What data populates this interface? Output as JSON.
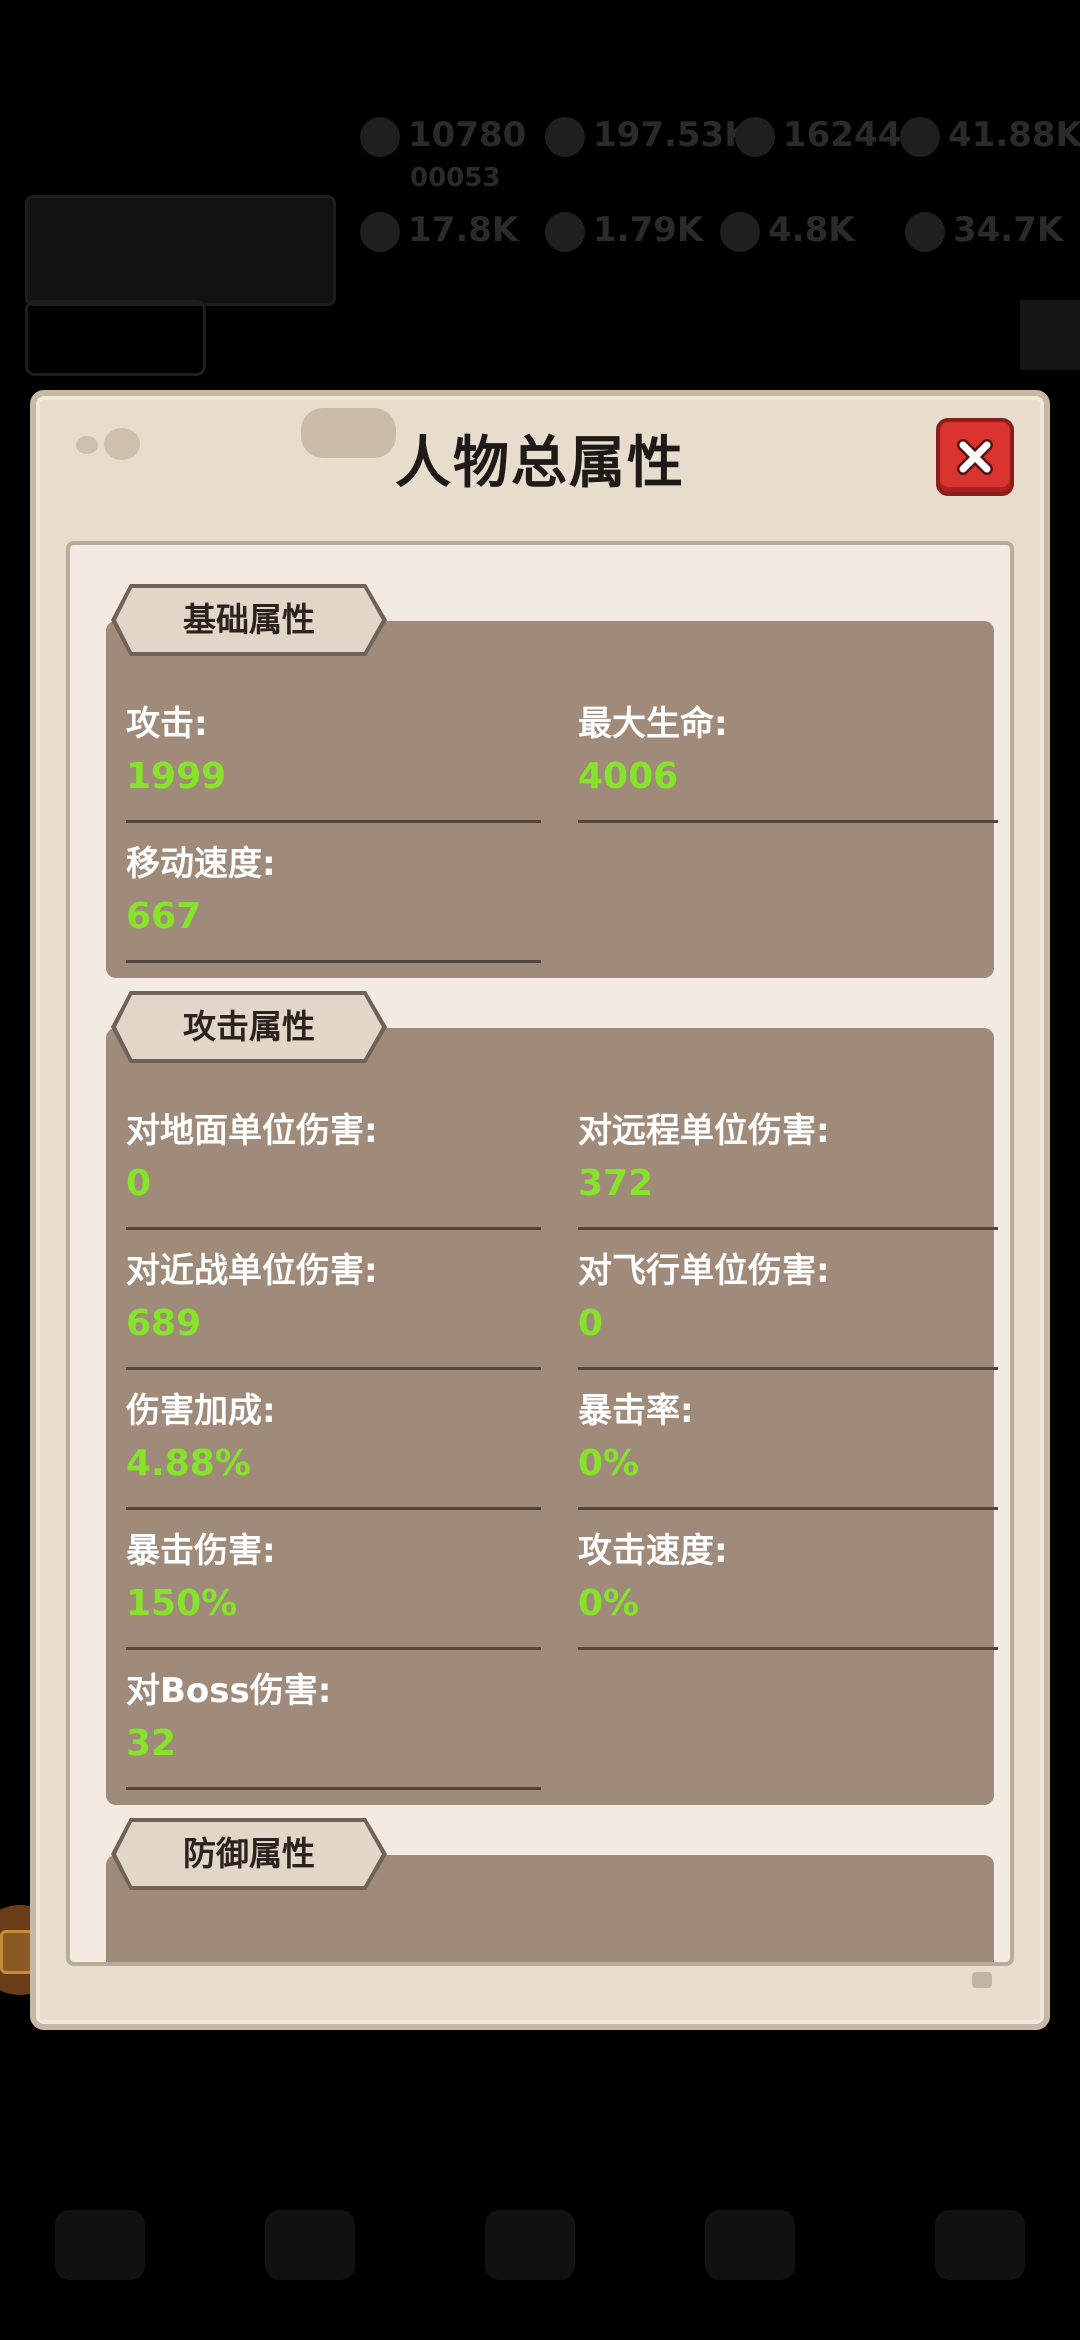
{
  "background": {
    "resources_row1": [
      "10780",
      "197.53K",
      "16244",
      "41.88K"
    ],
    "player_id": "00053",
    "resources_row2": [
      "17.8K",
      "1.79K",
      "4.8K",
      "34.7K"
    ],
    "tabs": [
      "",
      "",
      ""
    ],
    "bottom_nav": [
      "",
      "",
      "",
      "",
      ""
    ]
  },
  "modal": {
    "title": "人物总属性",
    "sections": [
      {
        "title": "基础属性",
        "stats": [
          {
            "label": "攻击:",
            "value": "1999"
          },
          {
            "label": "最大生命:",
            "value": "4006"
          },
          {
            "label": "移动速度:",
            "value": "667"
          }
        ]
      },
      {
        "title": "攻击属性",
        "stats": [
          {
            "label": "对地面单位伤害:",
            "value": "0"
          },
          {
            "label": "对远程单位伤害:",
            "value": "372"
          },
          {
            "label": "对近战单位伤害:",
            "value": "689"
          },
          {
            "label": "对飞行单位伤害:",
            "value": "0"
          },
          {
            "label": "伤害加成:",
            "value": "4.88%"
          },
          {
            "label": "暴击率:",
            "value": "0%"
          },
          {
            "label": "暴击伤害:",
            "value": "150%"
          },
          {
            "label": "攻击速度:",
            "value": "0%"
          },
          {
            "label": "对Boss伤害:",
            "value": "32"
          }
        ]
      },
      {
        "title": "防御属性",
        "stats": []
      }
    ]
  },
  "colors": {
    "value_green": "#86e22a",
    "panel_brown": "#a08b7b",
    "close_red": "#d9342f"
  }
}
